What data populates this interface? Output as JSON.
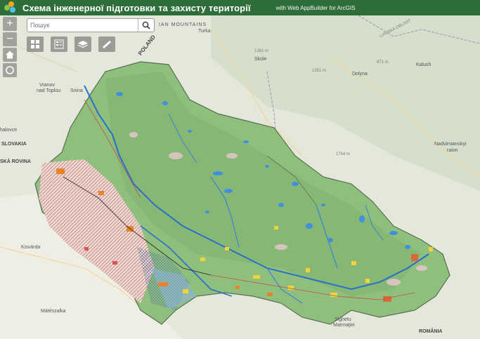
{
  "header": {
    "title": "Схема інженерної підготовки та захисту території",
    "subtitle": "with Web AppBuilder for ArcGIS"
  },
  "controls": {
    "zoom_in": "+",
    "zoom_out": "−"
  },
  "search": {
    "placeholder": "Пошук"
  },
  "map_labels": {
    "mountains": "IAN MOUNTAINS",
    "poland": "POLAND",
    "turka": "Turka",
    "skole": "Skole",
    "elev1261": "1261 m",
    "dolyna": "Dolyna",
    "elev1351": "1351 m",
    "elev871": "871 m",
    "kalush": "Kalush",
    "lvivska": "LVIVSKA OBLAST",
    "vranov": "Vranov",
    "nad_toplou": "nad Toplou",
    "snina": "Snina",
    "halovce": "halovce",
    "slovakia": "SLOVAKIA",
    "ska_rovina": "SKÁ ROVINA",
    "elev1744": "1744 m",
    "nadvirna": "Nadvirnianskyi",
    "nadvirna2": "raion",
    "kisvarda": "Kisvárda",
    "mateszalka": "Mátészalka",
    "sighetu": "Sighetu",
    "marmatiei": "Marmaţiei",
    "romania": "ROMÂNIA"
  },
  "icons": [
    "search-icon",
    "home-icon",
    "locate-icon",
    "basemap-gallery-icon",
    "legend-icon",
    "layers-icon",
    "measure-icon"
  ]
}
